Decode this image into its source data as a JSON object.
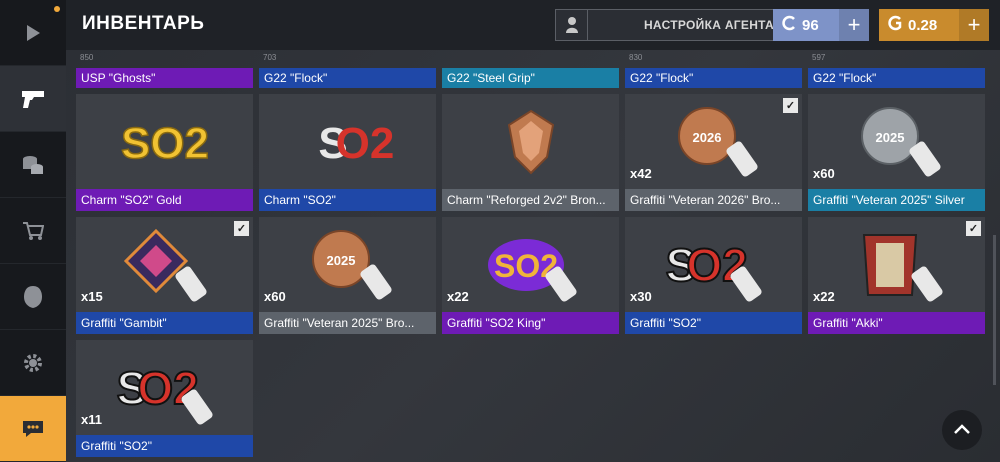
{
  "sidebar": {
    "items": [
      {
        "name": "play-icon"
      },
      {
        "name": "pistol-icon"
      },
      {
        "name": "coins-icon"
      },
      {
        "name": "cart-icon"
      },
      {
        "name": "helmet-icon"
      },
      {
        "name": "gear-icon"
      },
      {
        "name": "chat-icon"
      }
    ]
  },
  "header": {
    "title": "ИНВЕНТАРЬ",
    "agent_button": "НАСТРОЙКА АГЕНТА",
    "currency_blue": "96",
    "currency_gold": "0.28"
  },
  "colors": {
    "accent": "#f2a93b",
    "purple": "#6e1bb5",
    "blue": "#1f48a8",
    "teal": "#1a7fa5",
    "gray": "#5d636b"
  },
  "top_row": [
    {
      "num": "850",
      "label": "USP \"Ghosts\"",
      "rarity": "purple"
    },
    {
      "num": "703",
      "label": "G22 \"Flock\"",
      "rarity": "blue"
    },
    {
      "num": "",
      "label": "G22 \"Steel Grip\"",
      "rarity": "teal"
    },
    {
      "num": "830",
      "label": "G22 \"Flock\"",
      "rarity": "blue"
    },
    {
      "num": "597",
      "label": "G22 \"Flock\"",
      "rarity": "blue"
    }
  ],
  "items": [
    {
      "label": "Charm \"SO2\" Gold",
      "count": "",
      "rarity": "purple",
      "checked": false
    },
    {
      "label": "Charm \"SO2\"",
      "count": "",
      "rarity": "blue",
      "checked": false
    },
    {
      "label": "Charm \"Reforged 2v2\" Bron...",
      "count": "",
      "rarity": "gray",
      "checked": false
    },
    {
      "label": "Graffiti \"Veteran 2026\" Bro...",
      "count": "x42",
      "rarity": "gray",
      "checked": true
    },
    {
      "label": "Graffiti \"Veteran 2025\" Silver",
      "count": "x60",
      "rarity": "teal",
      "checked": false
    },
    {
      "label": "Graffiti \"Gambit\"",
      "count": "x15",
      "rarity": "blue",
      "checked": true
    },
    {
      "label": "Graffiti \"Veteran 2025\" Bro...",
      "count": "x60",
      "rarity": "gray",
      "checked": false
    },
    {
      "label": "Graffiti \"SO2 King\"",
      "count": "x22",
      "rarity": "purple",
      "checked": false
    },
    {
      "label": "Graffiti \"SO2\"",
      "count": "x30",
      "rarity": "blue",
      "checked": false
    },
    {
      "label": "Graffiti \"Akki\"",
      "count": "x22",
      "rarity": "purple",
      "checked": true
    },
    {
      "label": "Graffiti \"SO2\"",
      "count": "x11",
      "rarity": "blue",
      "checked": false
    }
  ]
}
